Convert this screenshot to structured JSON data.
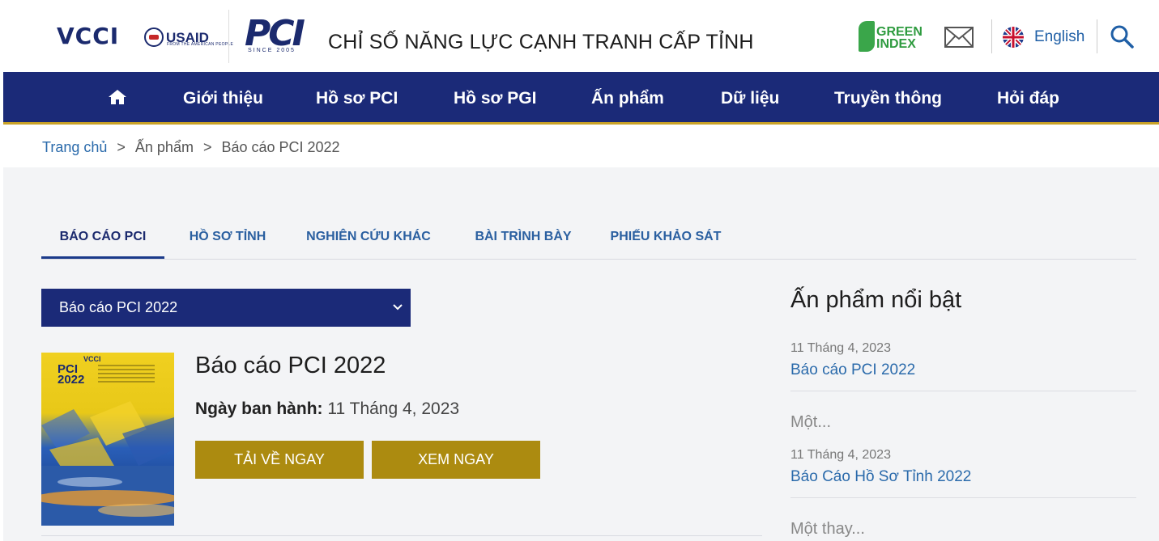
{
  "header": {
    "logo_vcci": "VCCI",
    "logo_usaid": "USAID",
    "logo_usaid_sub": "FROM THE AMERICAN PEOPLE",
    "logo_pci": "PCI",
    "logo_pci_since": "SINCE 2005",
    "site_title": "CHỈ SỐ NĂNG LỰC CẠNH TRANH CẤP TỈNH",
    "green_index": [
      "GREEN",
      "INDEX"
    ],
    "language_label": "English",
    "icons": [
      "mail-icon",
      "uk-flag-icon",
      "search-icon"
    ]
  },
  "nav": {
    "home_icon": "home-icon",
    "items": [
      "Giới thiệu",
      "Hồ sơ PCI",
      "Hồ sơ PGI",
      "Ấn phẩm",
      "Dữ liệu",
      "Truyền thông",
      "Hỏi đáp"
    ]
  },
  "breadcrumb": {
    "home": "Trang chủ",
    "section": "Ấn phẩm",
    "current": "Báo cáo PCI 2022",
    "separator": ">"
  },
  "tabs": [
    "BÁO CÁO PCI",
    "HỒ SƠ TỈNH",
    "NGHIÊN CỨU KHÁC",
    "BÀI TRÌNH BÀY",
    "PHIẾU KHẢO SÁT"
  ],
  "active_tab": "BÁO CÁO PCI",
  "filter": {
    "selected": "Báo cáo PCI 2022"
  },
  "publication": {
    "title": "Báo cáo PCI 2022",
    "date_label": "Ngày ban hành:",
    "date_value": "11 Tháng 4, 2023",
    "download_label": "TẢI VỀ NGAY",
    "view_label": "XEM NGAY",
    "cover": {
      "vcci": "VCCI",
      "pci": "PCI",
      "year": "2022"
    }
  },
  "featured": {
    "heading": "Ấn phẩm nổi bật",
    "items": [
      {
        "date": "11 Tháng 4, 2023",
        "title": "Báo cáo PCI 2022"
      },
      {
        "date": "11 Tháng 4, 2023",
        "title": "Báo Cáo Hồ Sơ Tỉnh 2022"
      }
    ],
    "descriptions": [
      "Một...",
      "Một thay..."
    ]
  },
  "colors": {
    "nav_bg": "#1b2a78",
    "accent_gold": "#ac8b10",
    "link_blue": "#2a6aab",
    "content_bg": "#f3f4f6"
  }
}
